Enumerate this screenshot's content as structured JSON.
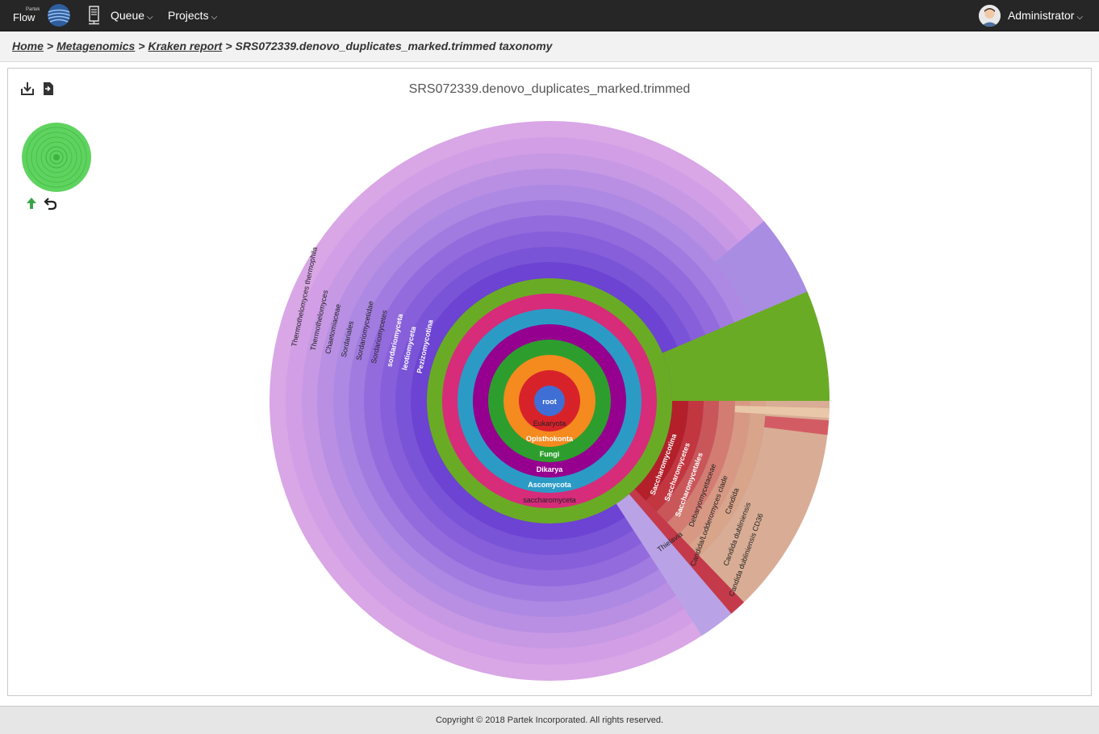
{
  "app": {
    "brand_small": "Partek",
    "brand_name": "Flow",
    "nav": [
      {
        "label": "Queue"
      },
      {
        "label": "Projects"
      }
    ],
    "user_name": "Administrator"
  },
  "breadcrumb": {
    "items": [
      "Home",
      "Metagenomics",
      "Kraken report"
    ],
    "separator": ">",
    "current": "SRS072339.denovo_duplicates_marked.trimmed taxonomy"
  },
  "toolbar": {
    "download_icon": "download-icon",
    "export_icon": "export-file-icon"
  },
  "chart": {
    "title": "SRS072339.denovo_duplicates_marked.trimmed",
    "nav_up_icon": "arrow-up-icon",
    "nav_back_icon": "undo-icon",
    "colors": {
      "root": "#3f6fd4",
      "eukaryota": "#d8222a",
      "opisthokonta": "#f58a1f",
      "fungi": "#2d9e2d",
      "dikarya": "#95008f",
      "ascomycota": "#2b9bc6",
      "saccharomyceta_ring": "#d62c7a",
      "pezizomycotina_ring": "#6aab25",
      "purple_ramp": [
        "#5f33cc",
        "#6c43d2",
        "#7a54d6",
        "#875fda",
        "#946bdd",
        "#a27be0",
        "#ad89e3",
        "#b98fe3",
        "#c799e5",
        "#d29ee6"
      ],
      "outer_lilac": "#d9a6e6",
      "green_outer": "#6aab25",
      "sacch_reds": [
        "#b3202a",
        "#c2363f",
        "#c9575a",
        "#d37c72",
        "#d89984",
        "#d8a48a",
        "#d9ad95"
      ]
    },
    "ring_labels": [
      "root",
      "Eukaryota",
      "Opisthokonta",
      "Fungi",
      "Dikarya",
      "Ascomycota",
      "saccharomyceta"
    ],
    "left_labels": [
      "Pezizomycotina",
      "leotiomyceta",
      "sordariomyceta",
      "Sordariomycetes",
      "Sordariomycetidae",
      "Sordariales",
      "Chaetomiaceae",
      "Thermothelomyces",
      "Thermothelomyces thermophila"
    ],
    "right_labels": [
      "Saccharomycotina",
      "Saccharomycetes",
      "Saccharomycetales",
      "Debaryomycetaceae",
      "Candida/Lodderomyces clade",
      "Candida",
      "Candida dubliniensis",
      "Candida dubliniensis CD36"
    ],
    "extra_label": "Thielavia"
  },
  "footer": {
    "copyright": "Copyright © 2018 Partek Incorporated. All rights reserved."
  }
}
